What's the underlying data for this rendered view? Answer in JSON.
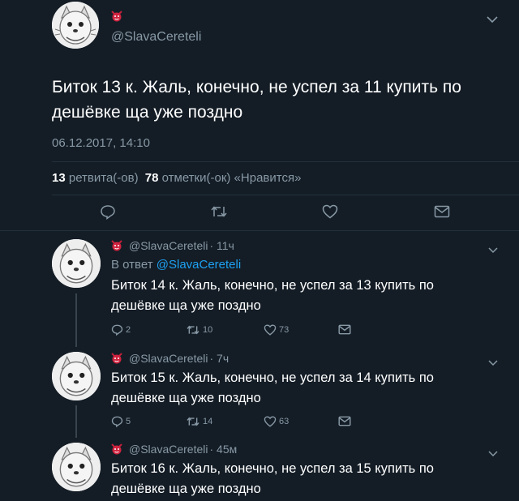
{
  "main_tweet": {
    "handle": "@SlavaCereteli",
    "text_line1": "Биток 13 к. Жаль, конечно, не успел за 11 купить по",
    "text_line2": "дешёвке ща уже поздно",
    "date": "06.12.2017, 14:10",
    "retweets_count": "13",
    "retweets_label": "ретвита(-ов)",
    "likes_count": "78",
    "likes_label": "отметки(-ок) «Нравится»"
  },
  "replies": [
    {
      "handle": "@SlavaCereteli",
      "time": "· 11ч",
      "reply_to_label": "В ответ",
      "reply_to_handle": "@SlavaCereteli",
      "text_line1": "Биток 14 к. Жаль, конечно, не успел за 13 купить по",
      "text_line2": "дешёвке ща уже поздно",
      "replies": "2",
      "retweets": "10",
      "likes": "73"
    },
    {
      "handle": "@SlavaCereteli",
      "time": "· 7ч",
      "text_line1": "Биток 15 к. Жаль, конечно, не успел за 14 купить по",
      "text_line2": "дешёвке ща уже поздно",
      "replies": "5",
      "retweets": "14",
      "likes": "63"
    },
    {
      "handle": "@SlavaCereteli",
      "time": "· 45м",
      "text_line1": "Биток 16 к. Жаль, конечно, не успел за 15 купить по",
      "text_line2": "дешёвке ща уже поздно"
    }
  ],
  "icons": {
    "reply": "reply-icon",
    "retweet": "retweet-icon",
    "like": "heart-icon",
    "share": "envelope-icon",
    "more": "chevron-down-icon"
  },
  "colors": {
    "background": "#141d26",
    "muted": "#8899a6",
    "link": "#1da1f2"
  }
}
